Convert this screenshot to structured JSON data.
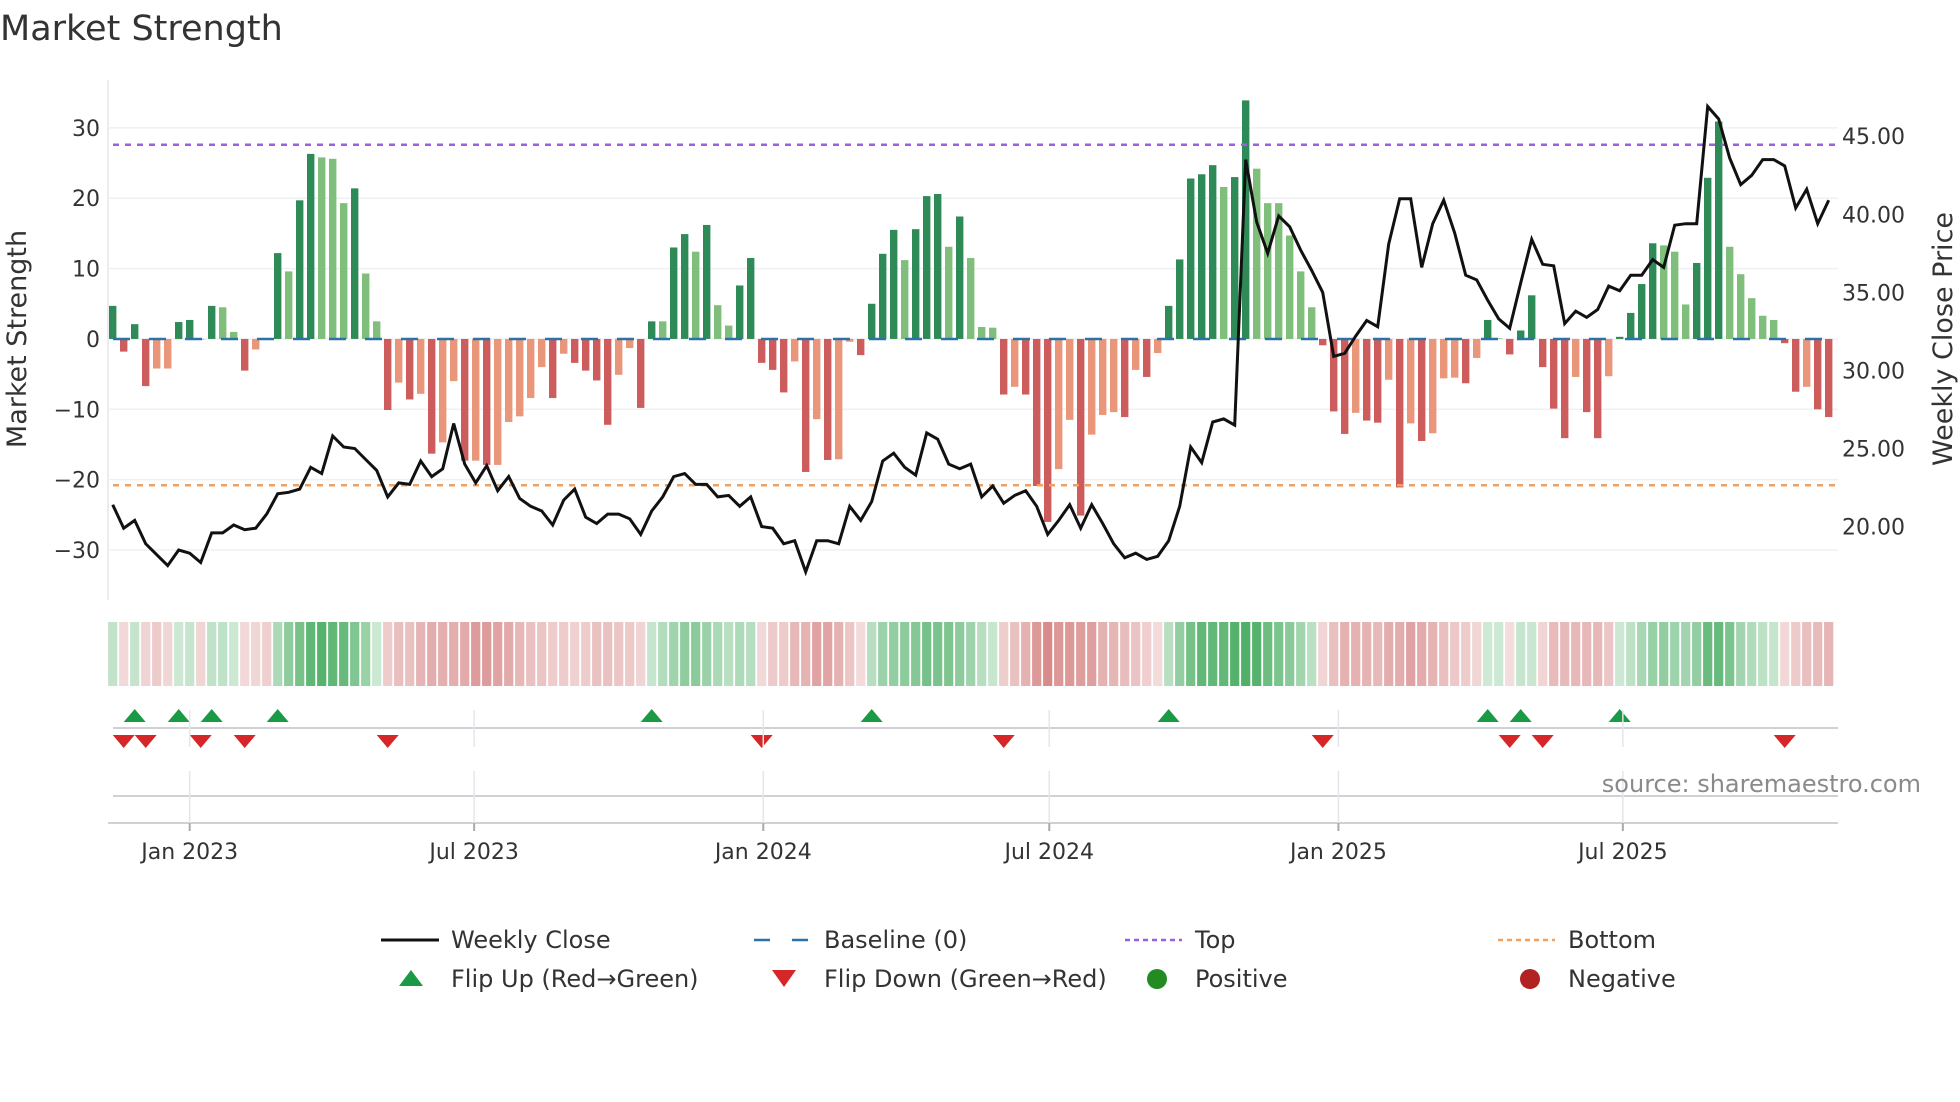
{
  "chart_data": {
    "type": "bar",
    "title": "Market Strength",
    "ylabel": "Market Strength",
    "ylabel_right": "Weekly Close Price",
    "source": "source: sharemaestro.com",
    "x_start": "2022-11-13",
    "x_step_days": 7,
    "ylim": [
      -37.1,
      36.8
    ],
    "ylim_right": [
      15.3,
      48.6
    ],
    "yticks": [
      30,
      20,
      10,
      0,
      -10,
      -20,
      -30
    ],
    "ytick_labels": [
      "30",
      "20",
      "10",
      "0",
      "−10",
      "−20",
      "−30"
    ],
    "yticks_right": [
      45,
      40,
      35,
      30,
      25,
      20
    ],
    "ytick_labels_right": [
      "45.00",
      "40.00",
      "35.00",
      "30.00",
      "25.00",
      "20.00"
    ],
    "xticks": [
      "2023-01-01",
      "2023-07-01",
      "2024-01-01",
      "2024-07-01",
      "2025-01-01",
      "2025-07-01"
    ],
    "xtick_labels": [
      "Jan 2023",
      "Jul 2023",
      "Jan 2024",
      "Jul 2024",
      "Jan 2025",
      "Jul 2025"
    ],
    "top_level": 27.6,
    "bottom_level": -20.8,
    "grid": true,
    "legend_position": "bottom",
    "colors": {
      "pos_strong": "#2e8b57",
      "pos_weak": "#7fbf7b",
      "neg_strong": "#cd5c5c",
      "neg_weak": "#e9967a",
      "close": "#111111",
      "baseline": "#2a72a8",
      "top": "#9b5fe0",
      "bottom": "#f0a060",
      "flip_up": "#1a9a45",
      "flip_down": "#d62728",
      "positive": "#228b22",
      "negative": "#b22222"
    },
    "series": [
      {
        "name": "Market Strength",
        "values": [
          4.7,
          -1.8,
          2.1,
          -6.7,
          -4.2,
          -4.2,
          2.4,
          2.7,
          0,
          4.7,
          4.5,
          1.0,
          -4.5,
          -1.5,
          0,
          12.2,
          9.6,
          19.7,
          26.3,
          25.8,
          25.6,
          19.3,
          21.4,
          9.3,
          2.5,
          -10.1,
          -6.2,
          -8.6,
          -7.8,
          -16.3,
          -14.7,
          -6.0,
          -17.3,
          -17.3,
          -17.9,
          -17.9,
          -11.8,
          -11.0,
          -8.4,
          -4.0,
          -8.4,
          -2.1,
          -3.4,
          -4.5,
          -5.9,
          -12.2,
          -5.1,
          -1.3,
          -9.8,
          2.5,
          2.5,
          13.0,
          14.9,
          12.4,
          16.2,
          4.8,
          1.9,
          7.6,
          11.5,
          -3.4,
          -4.4,
          -7.6,
          -3.2,
          -18.9,
          -11.4,
          -17.2,
          -17.1,
          -0.4,
          -2.3,
          5.0,
          12.1,
          15.5,
          11.2,
          15.6,
          20.3,
          20.6,
          13.1,
          17.4,
          11.5,
          1.7,
          1.6,
          -7.9,
          -6.8,
          -7.9,
          -20.9,
          -26.0,
          -18.5,
          -11.5,
          -25.1,
          -13.6,
          -10.8,
          -10.4,
          -11.1,
          -4.4,
          -5.4,
          -2.0,
          4.7,
          11.3,
          22.8,
          23.4,
          24.7,
          21.6,
          23.0,
          33.9,
          24.2,
          19.3,
          19.3,
          14.7,
          9.6,
          4.5,
          -0.9,
          -10.3,
          -13.5,
          -10.5,
          -11.6,
          -11.9,
          -5.8,
          -21.1,
          -12.0,
          -14.5,
          -13.4,
          -5.6,
          -5.5,
          -6.3,
          -2.7,
          2.7,
          0.1,
          -2.2,
          1.2,
          6.2,
          -4.0,
          -9.9,
          -14.1,
          -5.4,
          -10.4,
          -14.1,
          -5.3,
          0.3,
          3.7,
          7.8,
          13.6,
          13.3,
          12.4,
          4.9,
          10.8,
          22.9,
          30.9,
          13.1,
          9.2,
          5.8,
          3.3,
          2.7,
          -0.6,
          -7.5,
          -6.8,
          -10.0,
          -11.1
        ]
      },
      {
        "name": "Weekly Close",
        "axis": "right",
        "values": [
          21.4,
          19.9,
          20.4,
          18.9,
          18.2,
          17.5,
          18.5,
          18.3,
          17.7,
          19.6,
          19.6,
          20.1,
          19.8,
          19.9,
          20.8,
          22.1,
          22.2,
          22.4,
          23.8,
          23.4,
          25.8,
          25.1,
          25.0,
          24.3,
          23.6,
          21.9,
          22.8,
          22.7,
          24.2,
          23.2,
          23.7,
          26.6,
          24.0,
          22.8,
          23.9,
          22.3,
          23.2,
          21.8,
          21.3,
          21.0,
          20.1,
          21.7,
          22.4,
          20.6,
          20.2,
          20.8,
          20.8,
          20.5,
          19.5,
          21.0,
          21.9,
          23.2,
          23.4,
          22.7,
          22.7,
          21.9,
          22.0,
          21.3,
          21.9,
          20.0,
          19.9,
          18.9,
          19.1,
          17.1,
          19.1,
          19.1,
          18.9,
          21.3,
          20.4,
          21.6,
          24.2,
          24.7,
          23.8,
          23.3,
          26.0,
          25.6,
          24.0,
          23.7,
          24.0,
          21.9,
          22.6,
          21.5,
          22.0,
          22.3,
          21.3,
          19.5,
          20.4,
          21.4,
          19.9,
          21.4,
          20.2,
          18.9,
          18.0,
          18.3,
          17.9,
          18.1,
          19.1,
          21.3,
          25.1,
          24.1,
          26.7,
          26.9,
          26.5,
          43.5,
          39.5,
          37.5,
          39.9,
          39.2,
          37.7,
          36.4,
          35.0,
          30.9,
          31.1,
          32.2,
          33.2,
          32.8,
          38.1,
          41.0,
          41.0,
          36.6,
          39.4,
          40.9,
          38.8,
          36.1,
          35.8,
          34.5,
          33.3,
          32.7,
          35.6,
          38.4,
          36.8,
          36.7,
          33.0,
          33.8,
          33.4,
          33.9,
          35.4,
          35.1,
          36.1,
          36.1,
          37.1,
          36.6,
          39.3,
          39.4,
          39.4,
          46.9,
          46.1,
          43.6,
          41.9,
          42.5,
          43.5,
          43.5,
          43.1,
          40.4,
          41.6,
          39.4,
          40.9
        ]
      }
    ],
    "legend": [
      {
        "label": "Weekly Close",
        "icon": "line-icon"
      },
      {
        "label": "Baseline (0)",
        "icon": "dashed-line-icon"
      },
      {
        "label": "Top",
        "icon": "dotted-line-icon"
      },
      {
        "label": "Bottom",
        "icon": "dotted-line-icon"
      },
      {
        "label": "Flip Up (Red→Green)",
        "icon": "triangle-up-icon"
      },
      {
        "label": "Flip Down (Green→Red)",
        "icon": "triangle-down-icon"
      },
      {
        "label": "Positive",
        "icon": "circle-icon"
      },
      {
        "label": "Negative",
        "icon": "circle-icon"
      }
    ]
  }
}
